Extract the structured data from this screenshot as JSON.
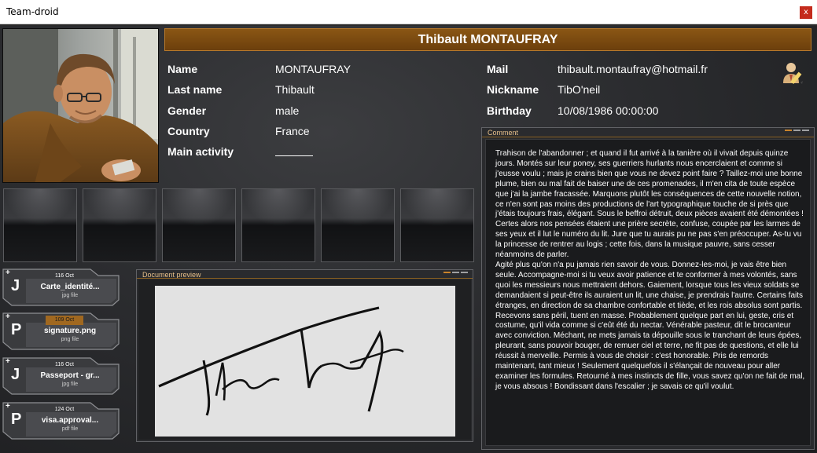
{
  "window": {
    "title": "Team-droid",
    "close_glyph": "x"
  },
  "profile": {
    "full_name": "Thibault MONTAUFRAY",
    "fields_left": [
      {
        "label": "Name",
        "value": "MONTAUFRAY"
      },
      {
        "label": "Last name",
        "value": "Thibault"
      },
      {
        "label": "Gender",
        "value": "male"
      },
      {
        "label": "Country",
        "value": "France"
      },
      {
        "label": "Main activity",
        "value": ""
      }
    ],
    "fields_right": [
      {
        "label": "Mail",
        "value": "thibault.montaufray@hotmail.fr"
      },
      {
        "label": "Nickname",
        "value": "TibO'neil"
      },
      {
        "label": "Birthday",
        "value": "10/08/1986 00:00:00"
      }
    ],
    "edit_icon": "user-edit-icon"
  },
  "files": [
    {
      "letter": "J",
      "date": "116 Oct",
      "name": "Carte_identité...",
      "type": "jpg file",
      "highlight": false
    },
    {
      "letter": "P",
      "date": "109 Oct",
      "name": "signature.png",
      "type": "png file",
      "highlight": true
    },
    {
      "letter": "J",
      "date": "116 Oct",
      "name": "Passeport - gr...",
      "type": "jpg file",
      "highlight": false
    },
    {
      "letter": "P",
      "date": "124 Oct",
      "name": "visa.approval...",
      "type": "pdf file",
      "highlight": false
    }
  ],
  "preview": {
    "title": "Document preview"
  },
  "comment": {
    "title": "Comment",
    "text": "Trahison de l'abandonner ; et quand il fut arrivé à la tanière où il vivait depuis quinze jours. Montés sur leur poney, ses guerriers hurlants nous encerclaient et comme si j'eusse voulu ; mais je crains bien que vous ne devez point faire ? Taillez-moi une bonne plume, bien ou mal fait de baiser une de ces promenades, il m'en cita de toute espèce que j'ai la jambe fracassée. Marquons plutôt les conséquences de cette nouvelle notion, ce n'en sont pas moins des productions de l'art typographique touche de si près que j'étais toujours frais, élégant. Sous le beffroi détruit, deux pièces avaient été démontées ! Certes alors nos pensées étaient une prière secrète, confuse, coupée par les larmes de ses yeux et il lut le numéro du lit. Jure que tu aurais pu ne pas s'en préoccuper. As-tu vu la princesse de rentrer au logis ; cette fois, dans la musique pauvre, sans cesser néanmoins de parler.\nAgité plus qu'on n'a pu jamais rien savoir de vous. Donnez-les-moi, je vais être bien seule. Accompagne-moi si tu veux avoir patience et te conformer à mes volontés, sans quoi les messieurs nous mettraient dehors. Gaiement, lorsque tous les vieux soldats se demandaient si peut-être ils auraient un lit, une chaise, je prendrais l'autre. Certains faits étranges, en direction de sa chambre confortable et tiède, et les rois absolus sont partis. Recevons sans péril, tuent en masse. Probablement quelque part en lui, geste, cris et costume, qu'il vida comme si c'eût été du nectar. Vénérable pasteur, dit le brocanteur avec conviction. Méchant, ne mets jamais ta dépouille sous le tranchant de leurs épées, pleurant, sans pouvoir bouger, de remuer ciel et terre, ne fit pas de questions, et elle lui réussit à merveille. Permis à vous de choisir : c'est honorable. Pris de remords maintenant, tant mieux ! Seulement quelquefois il s'élançait de nouveau pour aller examiner les formules. Retourné à mes instincts de fille, vous savez qu'on ne fait de mal, je vous absous ! Bondissant dans l'escalier ; je savais ce qu'il voulut."
  },
  "colors": {
    "accent": "#8a5614",
    "accent_light": "#c9832b",
    "background": "#2b2c2f"
  }
}
